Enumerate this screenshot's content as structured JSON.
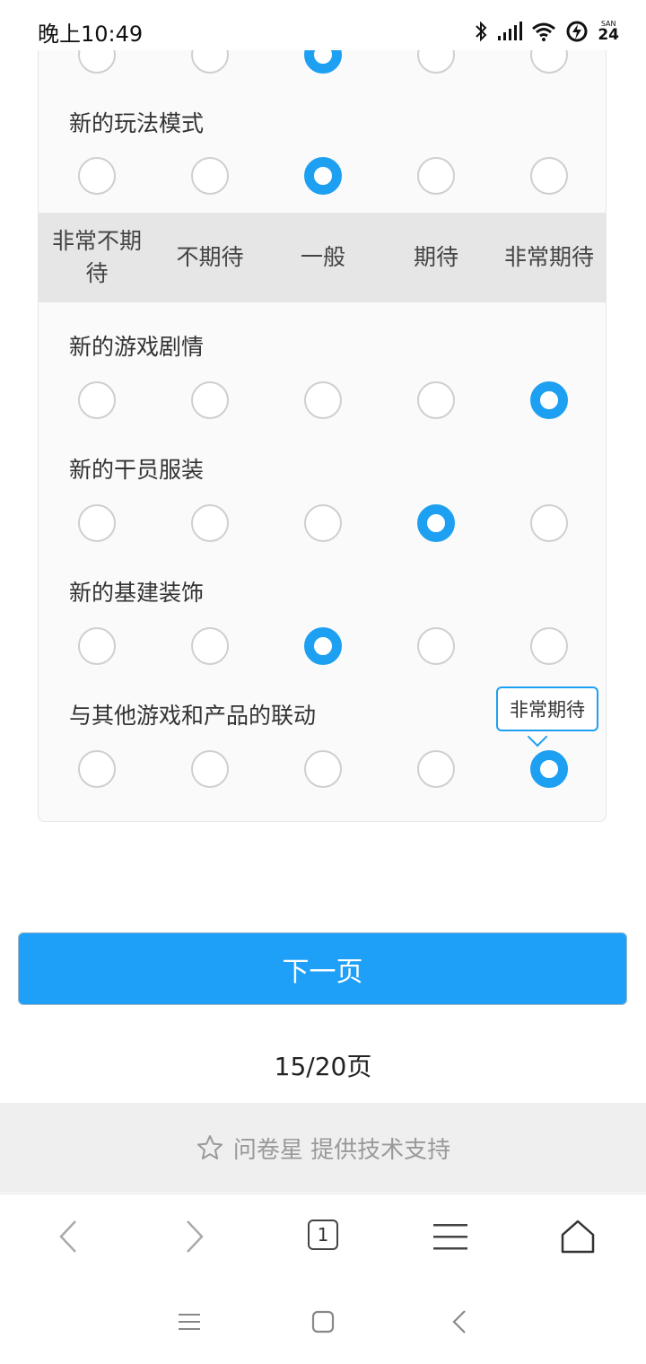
{
  "status_bar": {
    "time": "晚上10:49",
    "battery_top": "SAN",
    "battery_level": "24"
  },
  "survey": {
    "scale_labels": [
      "非常不期待",
      "不期待",
      "一般",
      "期待",
      "非常期待"
    ],
    "questions": [
      {
        "title": "",
        "selected_index": 2
      },
      {
        "title": "新的玩法模式",
        "selected_index": 2
      },
      {
        "title": "新的游戏剧情",
        "selected_index": 4
      },
      {
        "title": "新的干员服装",
        "selected_index": 3
      },
      {
        "title": "新的基建装饰",
        "selected_index": 2
      },
      {
        "title": "与其他游戏和产品的联动",
        "selected_index": 4
      }
    ],
    "tooltip": "非常期待"
  },
  "actions": {
    "next_label": "下一页",
    "page_indicator": "15/20页"
  },
  "footer": {
    "support_text": "问卷星 提供技术支持",
    "icon": "star-outline-icon"
  },
  "browser_bar": {
    "tab_count": "1"
  },
  "colors": {
    "accent": "#1ea0f2",
    "button": "#1ea0f8",
    "header_bg": "#e6e6e6",
    "footer_bg": "#efefef"
  }
}
